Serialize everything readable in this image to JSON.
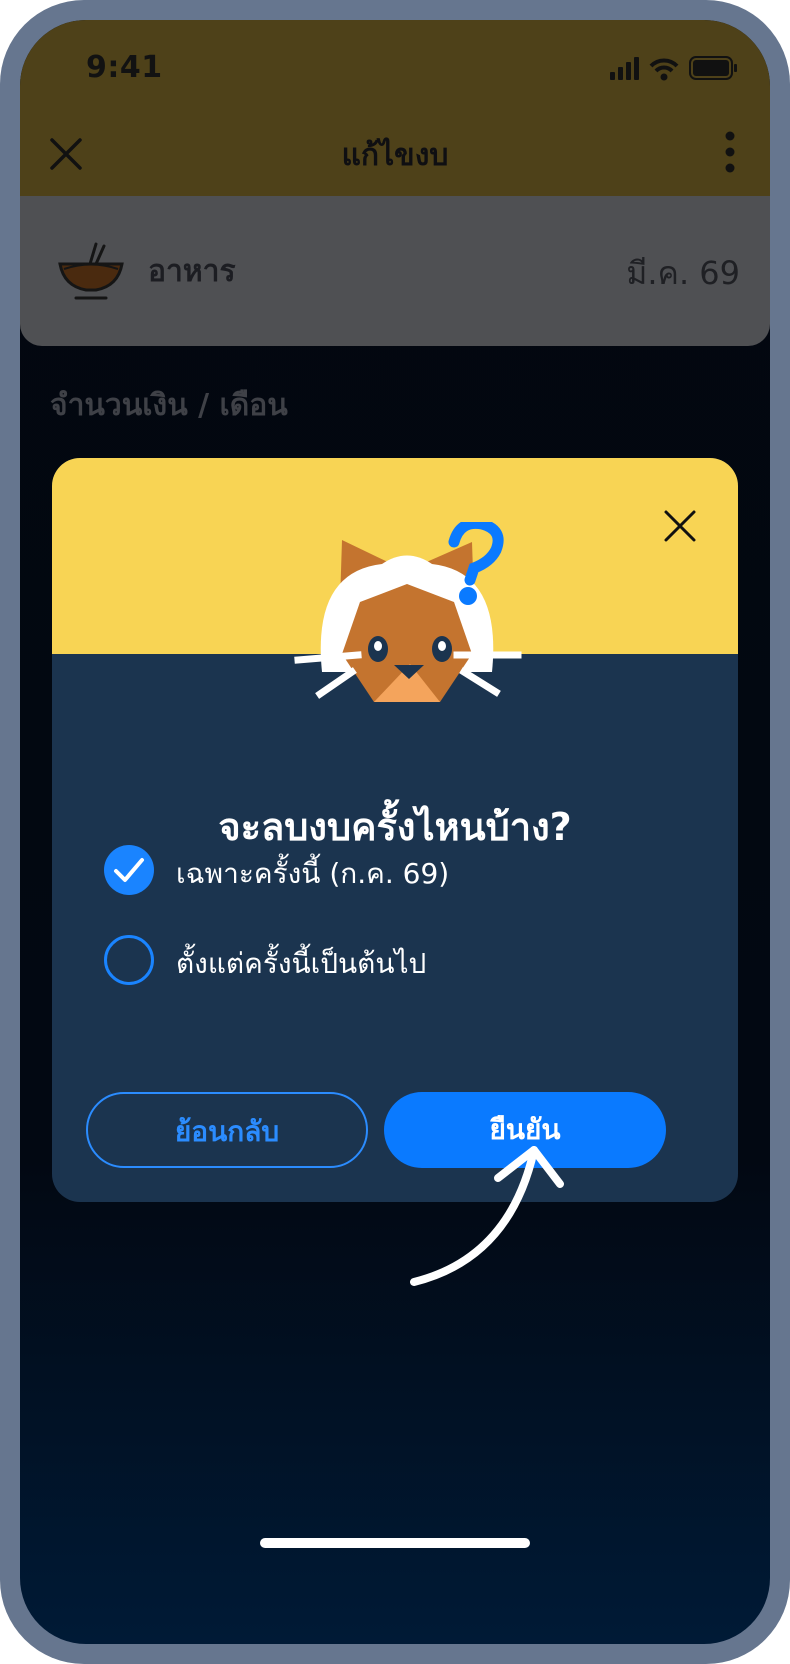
{
  "status_bar": {
    "time": "9:41"
  },
  "header": {
    "title": "แก้ไขงบ"
  },
  "category": {
    "icon": "noodle-bowl-icon",
    "name": "อาหาร",
    "month": "มี.ค. 69"
  },
  "amount_label": "จำนวนเงิน / เดือน",
  "dialog": {
    "title": "จะลบงบครั้งไหนบ้าง?",
    "options": [
      {
        "label": "เฉพาะครั้งนี้ (ก.ค. 69)",
        "selected": true
      },
      {
        "label": "ตั้งแต่ครั้งนี้เป็นต้นไป",
        "selected": false
      }
    ],
    "back_label": "ย้อนกลับ",
    "confirm_label": "ยืนยัน"
  },
  "colors": {
    "accent": "#0a7aff",
    "dialog_header": "#f8d454",
    "dialog_body": "#1b344f"
  }
}
